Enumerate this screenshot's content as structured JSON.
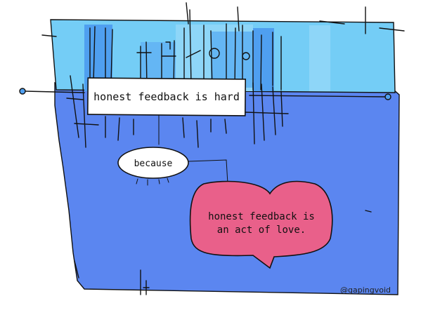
{
  "cartoon": {
    "top_box_text": "honest feedback is hard",
    "middle_bubble_text": "because",
    "heart_text_line1": "honest feedback is",
    "heart_text_line2": "an act of love.",
    "signature": "@gapingvoid"
  },
  "colors": {
    "background": "#ffffff",
    "sky_light": "#74cdf6",
    "sky_mid": "#8ed6f8",
    "sky_blue": "#4f9ff0",
    "main_blue": "#5b86f0",
    "heart_pink": "#e9608a",
    "ink": "#111111"
  },
  "icons": [
    "city-skyline-icon",
    "speech-bubble-icon",
    "heart-icon"
  ]
}
